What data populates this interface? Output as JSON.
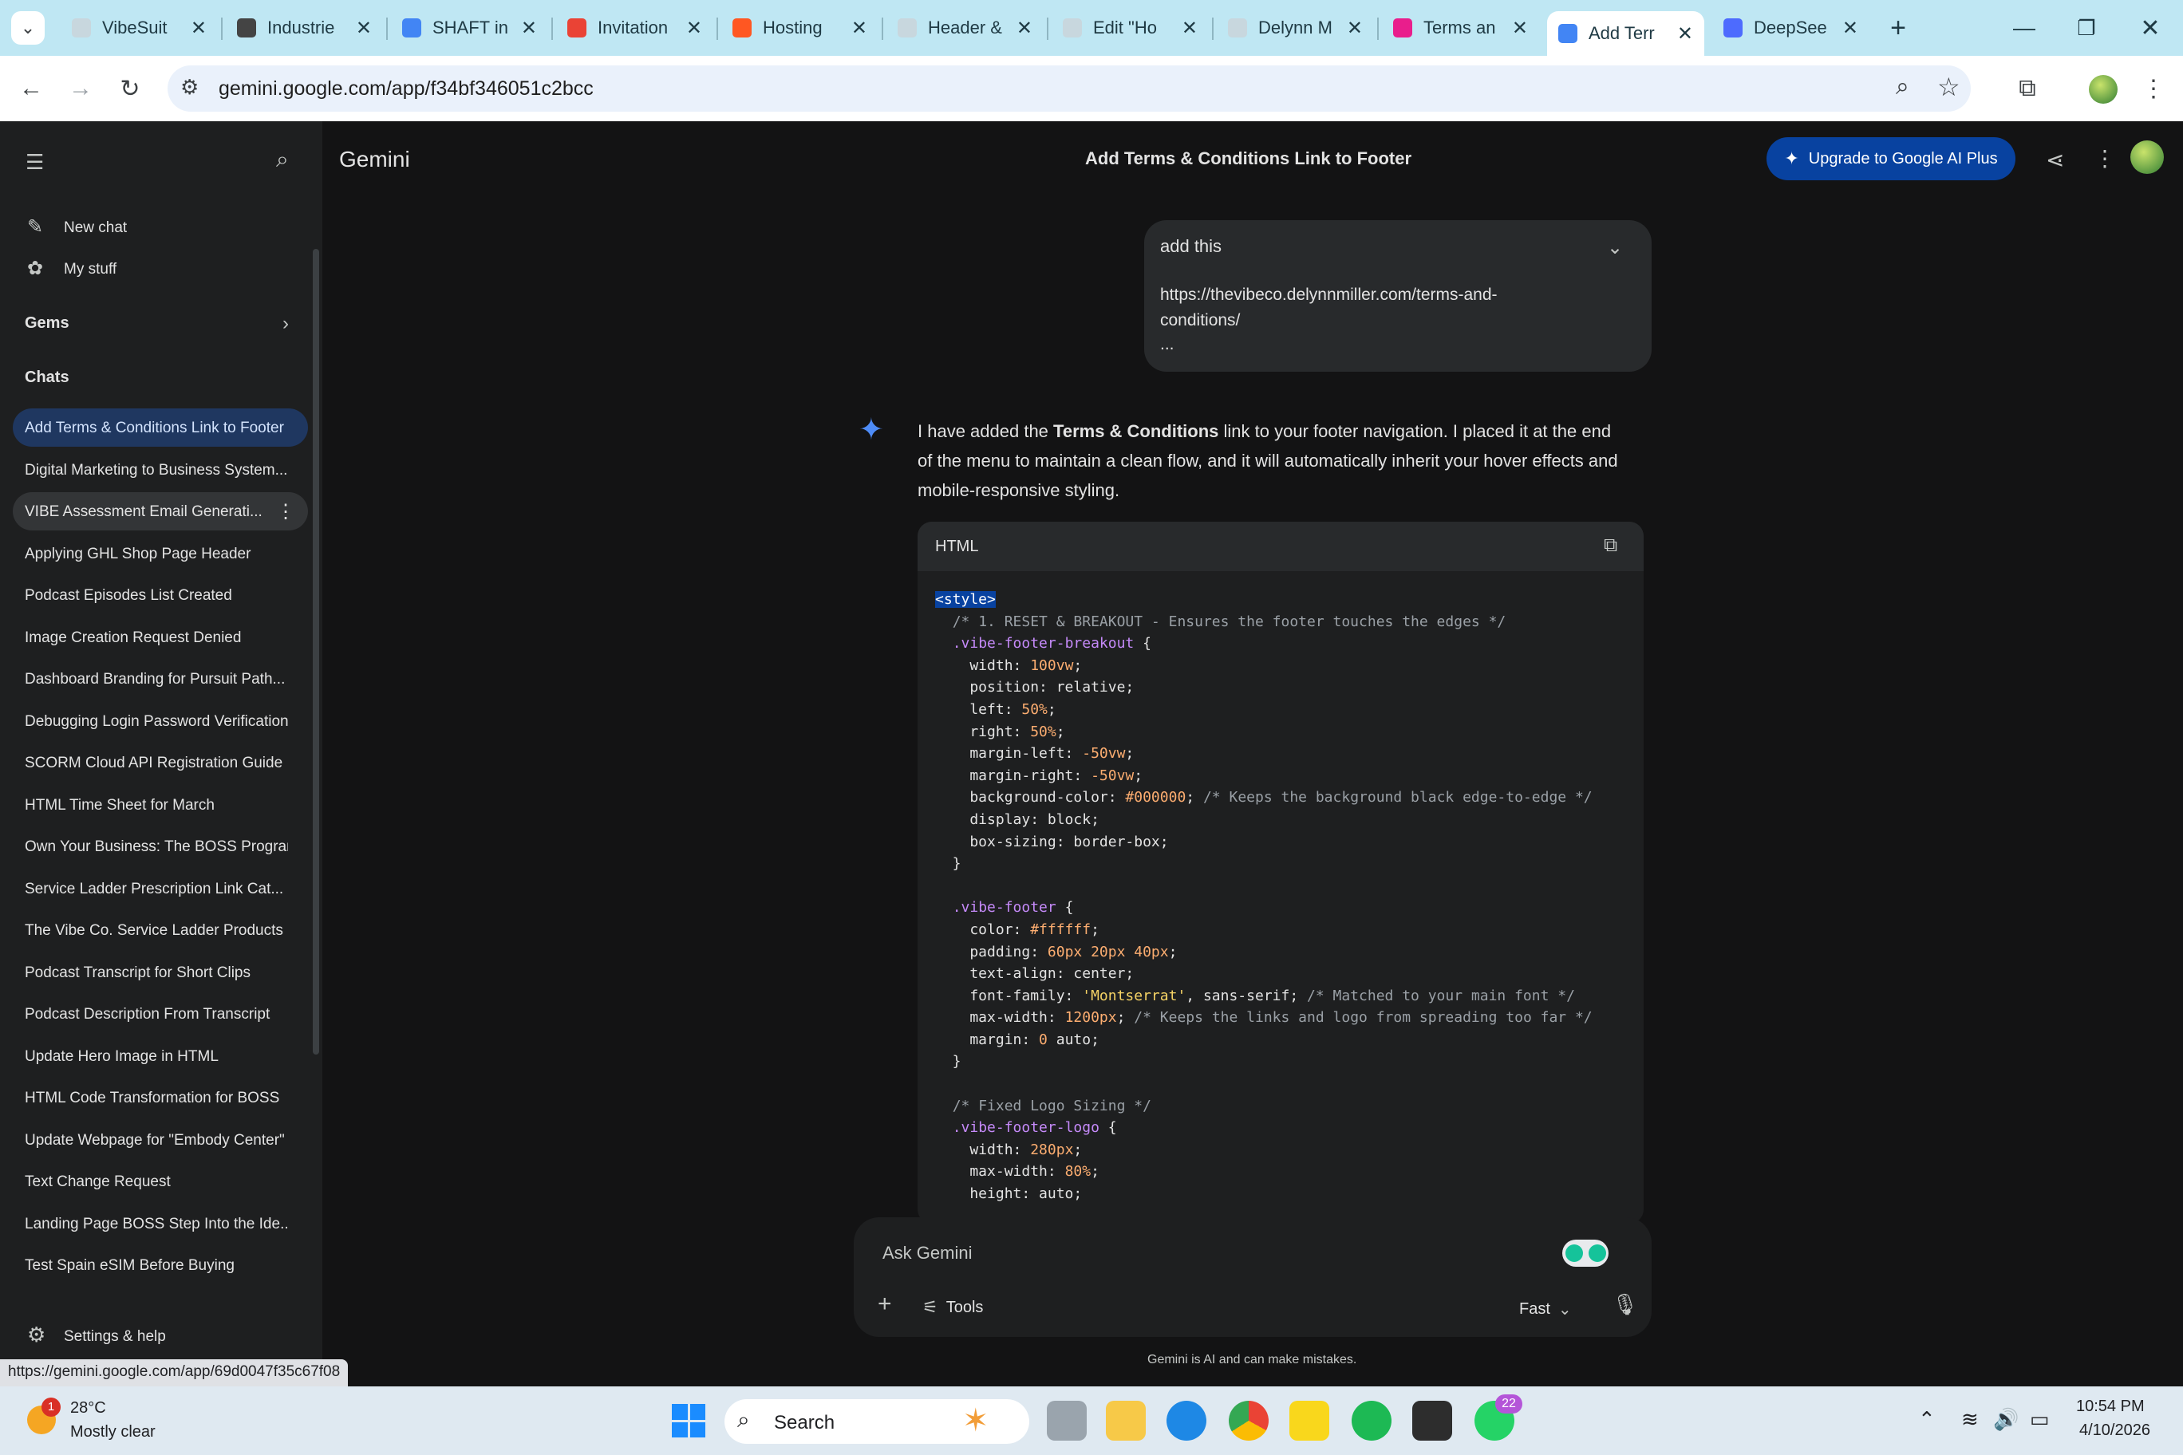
{
  "browser": {
    "tabs": [
      {
        "label": "VibeSuit",
        "color": "#c8d7de"
      },
      {
        "label": "Industrie",
        "color": "#444444"
      },
      {
        "label": "SHAFT in",
        "color": "#4285f4"
      },
      {
        "label": "Invitation",
        "color": "#ea4335"
      },
      {
        "label": "Hosting",
        "color": "#ff5722"
      },
      {
        "label": "Header &",
        "color": "#c8d7de"
      },
      {
        "label": "Edit \"Ho",
        "color": "#c8d7de"
      },
      {
        "label": "Delynn M",
        "color": "#c8d7de"
      },
      {
        "label": "Terms an",
        "color": "#e91e8c"
      },
      {
        "label": "Add Terr",
        "color": "#4285f4"
      },
      {
        "label": "DeepSee",
        "color": "#4d6bfe"
      }
    ],
    "active_tab_index": 9,
    "url": "gemini.google.com/app/f34bf346051c2bcc",
    "status_url": "https://gemini.google.com/app/69d0047f35c67f08"
  },
  "app": {
    "brand": "Gemini",
    "chat_title": "Add Terms & Conditions Link to Footer",
    "upgrade_label": "Upgrade to Google AI Plus",
    "sidebar": {
      "new_chat": "New chat",
      "my_stuff": "My stuff",
      "gems": "Gems",
      "chats": "Chats",
      "settings": "Settings & help",
      "chat_items": [
        "Add Terms & Conditions Link to Footer",
        "Digital Marketing to Business System...",
        "VIBE Assessment Email Generati...",
        "Applying GHL Shop Page Header",
        "Podcast Episodes List Created",
        "Image Creation Request Denied",
        "Dashboard Branding for Pursuit Path...",
        "Debugging Login Password Verification",
        "SCORM Cloud API Registration Guide",
        "HTML Time Sheet for March",
        "Own Your Business: The BOSS Program",
        "Service Ladder Prescription Link Cat...",
        "The Vibe Co. Service Ladder Products",
        "Podcast Transcript for Short Clips",
        "Podcast Description From Transcript",
        "Update Hero Image in HTML",
        "HTML Code Transformation for BOSS",
        "Update Webpage for \"Embody Center\"",
        "Text Change Request",
        "Landing Page  BOSS Step Into the Ide...",
        "Test Spain eSIM Before Buying"
      ]
    },
    "user_message": {
      "line1": "add this",
      "line2": "https://thevibeco.delynnmiller.com/terms-and-",
      "line3": "conditions/",
      "line4": "..."
    },
    "response": {
      "p_start": "I have added the ",
      "p_bold": "Terms & Conditions",
      "p_end": " link to your footer navigation. I placed it at the end of the menu to maintain a clean flow, and it will automatically inherit your hover effects and mobile-responsive styling."
    },
    "code_block": {
      "language": "HTML"
    },
    "input": {
      "placeholder": "Ask Gemini",
      "tools_label": "Tools",
      "mode_label": "Fast",
      "disclaimer": "Gemini is AI and can make mistakes."
    }
  },
  "taskbar": {
    "weather_temp": "28°C",
    "weather_desc": "Mostly clear",
    "weather_badge": "1",
    "search_label": "Search",
    "whatsapp_badge": "22",
    "time": "10:54 PM",
    "date": "4/10/2026"
  }
}
